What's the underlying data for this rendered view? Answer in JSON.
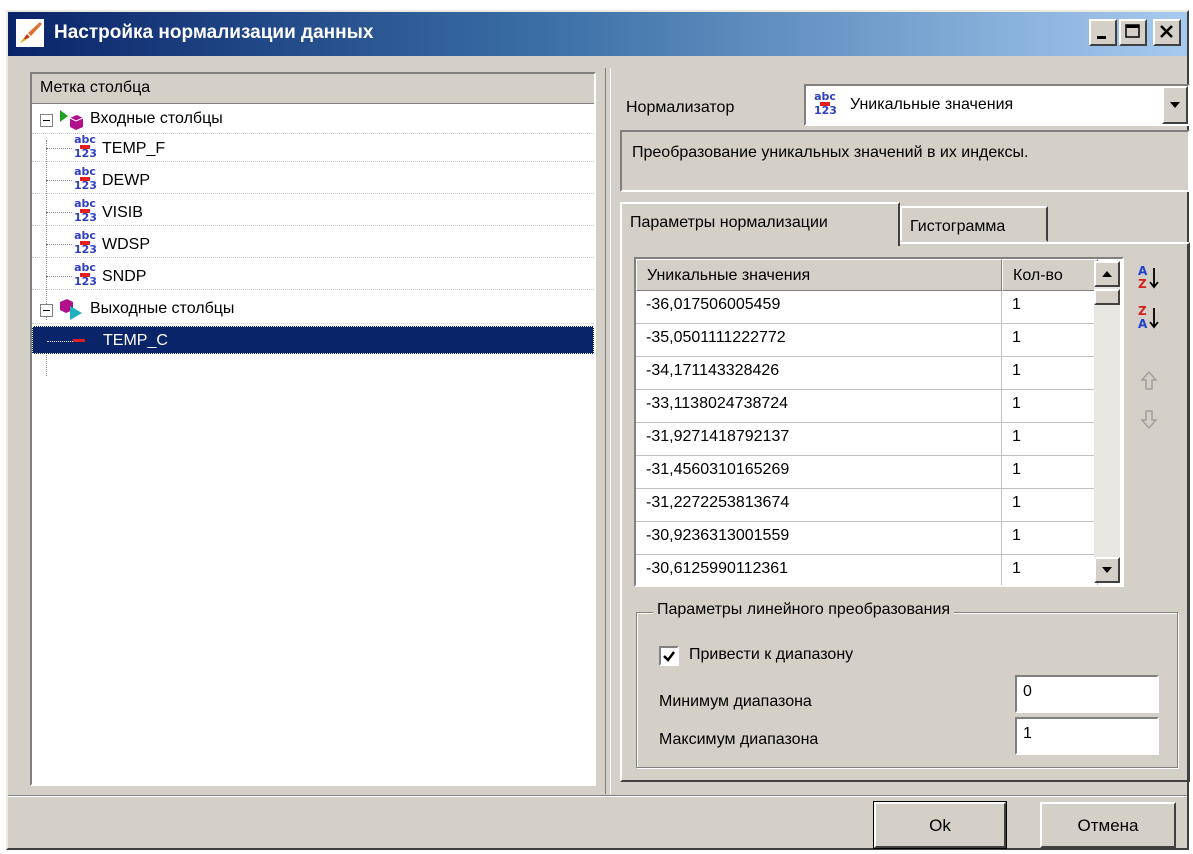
{
  "window": {
    "title": "Настройка нормализации данных"
  },
  "tree": {
    "header": "Метка столбца",
    "input_group": "Входные столбцы",
    "input_items": [
      "TEMP_F",
      "DEWP",
      "VISIB",
      "WDSP",
      "SNDP"
    ],
    "output_group": "Выходные столбцы",
    "output_items": [
      "TEMP_C"
    ],
    "selected": "TEMP_C"
  },
  "normalizer": {
    "label": "Нормализатор",
    "value": "Уникальные значения",
    "description": "Преобразование уникальных значений в их индексы."
  },
  "tabs": [
    {
      "label": "Параметры нормализации",
      "active": true
    },
    {
      "label": "Гистограмма",
      "active": false
    }
  ],
  "grid": {
    "col_value": "Уникальные значения",
    "col_count": "Кол-во",
    "rows": [
      {
        "value": "-36,017506005459",
        "count": "1"
      },
      {
        "value": "-35,0501111222772",
        "count": "1"
      },
      {
        "value": "-34,171143328426",
        "count": "1"
      },
      {
        "value": "-33,1138024738724",
        "count": "1"
      },
      {
        "value": "-31,9271418792137",
        "count": "1"
      },
      {
        "value": "-31,4560310165269",
        "count": "1"
      },
      {
        "value": "-31,2272253813674",
        "count": "1"
      },
      {
        "value": "-30,9236313001559",
        "count": "1"
      },
      {
        "value": "-30,6125990112361",
        "count": "1"
      }
    ]
  },
  "linear": {
    "group_title": "Параметры линейного преобразования",
    "checkbox_label": "Привести к диапазону",
    "checkbox_checked": true,
    "min_label": "Минимум диапазона",
    "min_value": "0",
    "max_label": "Максимум диапазона",
    "max_value": "1"
  },
  "buttons": {
    "ok": "Ok",
    "cancel": "Отмена"
  },
  "icons": {
    "title": "brush-icon",
    "column_type": "abc-123-icon",
    "sort_asc": "sort-az-icon",
    "sort_desc": "sort-za-icon",
    "move_up": "arrow-up-icon",
    "move_down": "arrow-down-icon"
  }
}
